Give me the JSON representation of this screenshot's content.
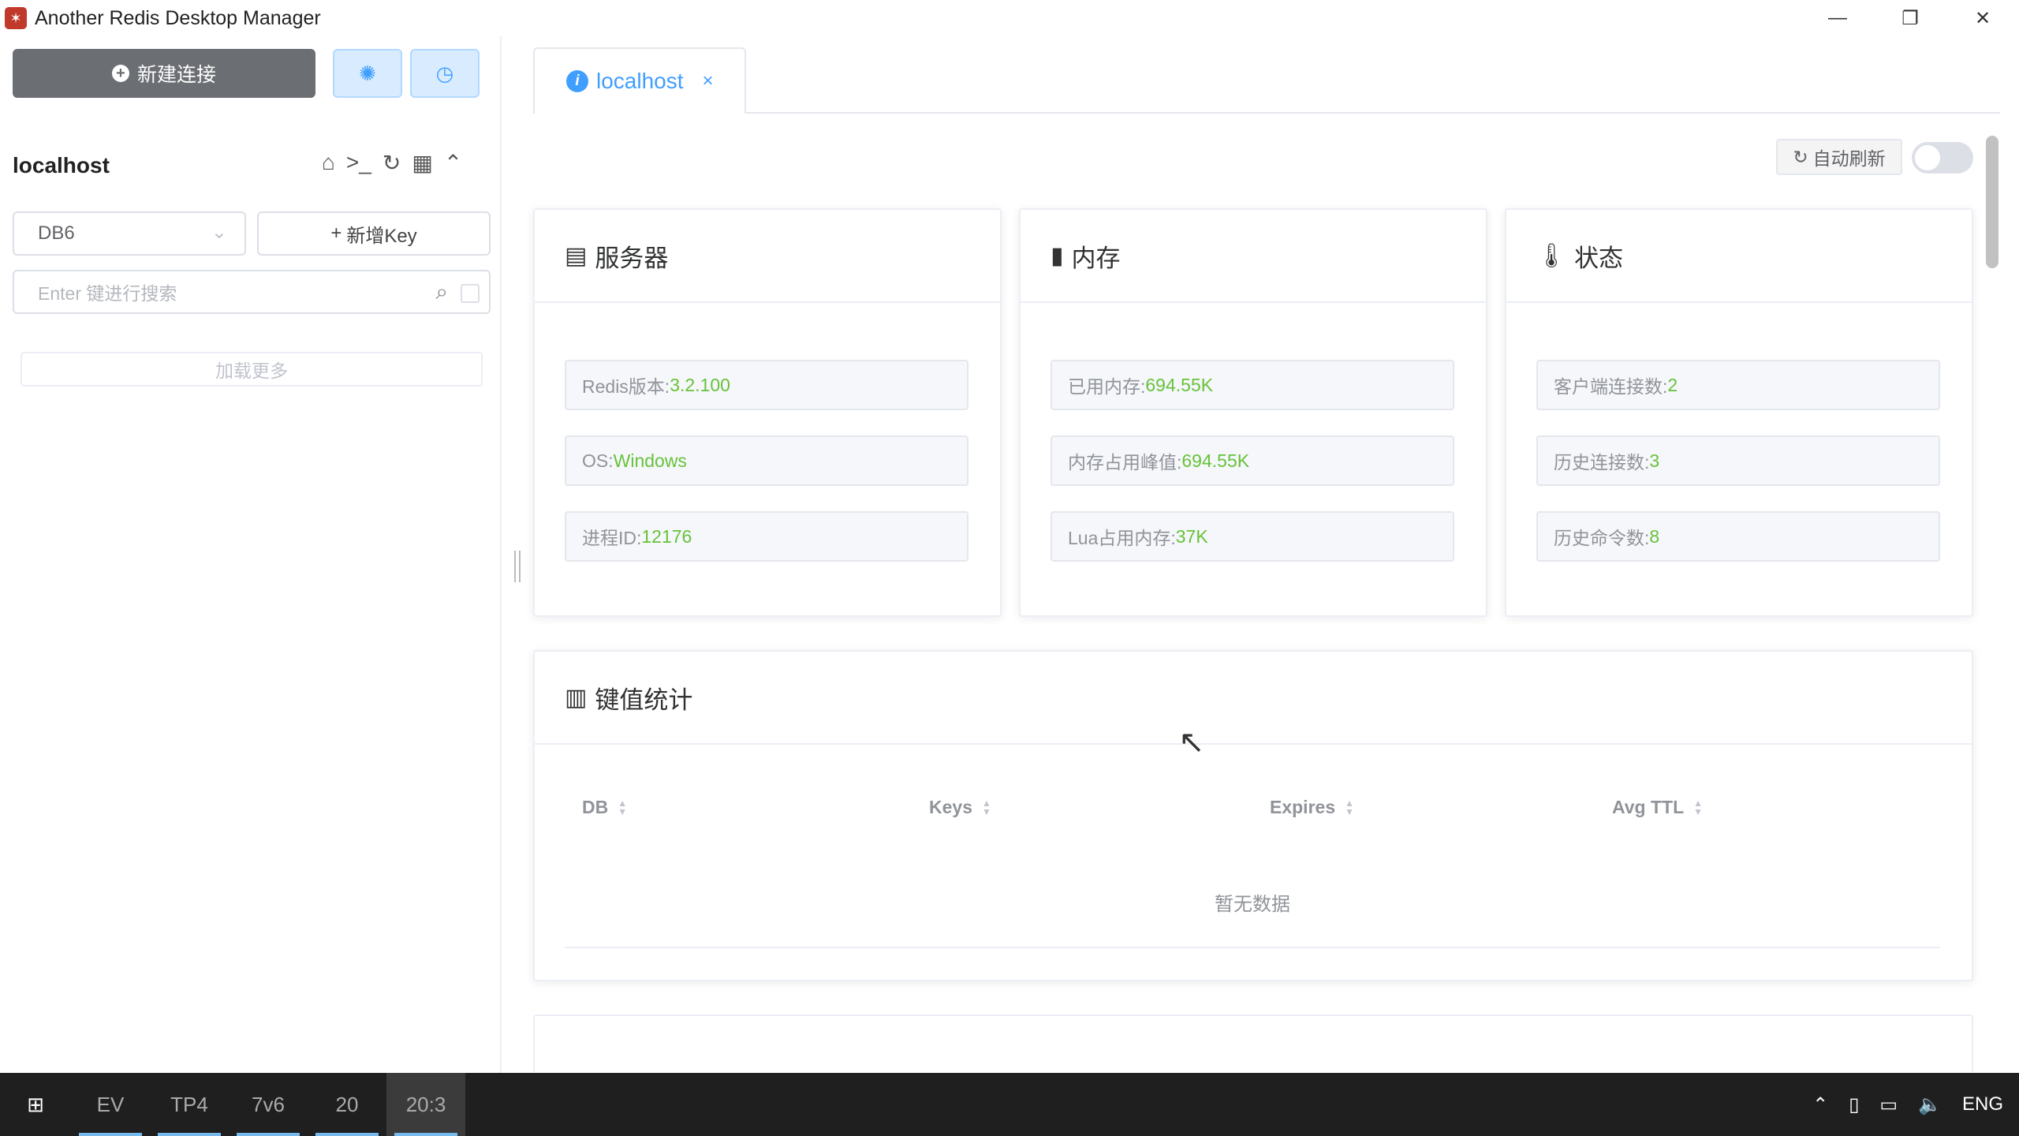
{
  "window": {
    "title": "Another Redis Desktop Manager",
    "minimize": "—",
    "restore": "❐",
    "close": "✕"
  },
  "sidebar": {
    "new_connection_label": "新建连接",
    "connection_name": "localhost",
    "db_selected": "DB6",
    "add_key_label": "新增Key",
    "search_placeholder": "Enter 键进行搜索",
    "load_more_label": "加载更多"
  },
  "tab": {
    "label": "localhost",
    "close": "×"
  },
  "toolbar": {
    "auto_refresh_label": "自动刷新",
    "auto_refresh_on": false
  },
  "server_card": {
    "title": "服务器",
    "rows": [
      {
        "label": "Redis版本: ",
        "value": "3.2.100"
      },
      {
        "label": "OS: ",
        "value": "Windows"
      },
      {
        "label": "进程ID: ",
        "value": "12176"
      }
    ]
  },
  "memory_card": {
    "title": "内存",
    "rows": [
      {
        "label": "已用内存: ",
        "value": "694.55K"
      },
      {
        "label": "内存占用峰值: ",
        "value": "694.55K"
      },
      {
        "label": "Lua占用内存: ",
        "value": "37K"
      }
    ]
  },
  "status_card": {
    "title": "状态",
    "rows": [
      {
        "label": "客户端连接数: ",
        "value": "2"
      },
      {
        "label": "历史连接数: ",
        "value": "3"
      },
      {
        "label": "历史命令数: ",
        "value": "8"
      }
    ]
  },
  "keystats_card": {
    "title": "键值统计",
    "columns": [
      "DB",
      "Keys",
      "Expires",
      "Avg TTL"
    ],
    "empty_text": "暂无数据"
  },
  "taskbar": {
    "items": [
      "EV",
      "TP4",
      "7v6",
      "20",
      "20:3"
    ],
    "tray_lang": "ENG"
  },
  "colors": {
    "primary": "#409eff",
    "value_green": "#67c23a",
    "new_conn_bg": "#6b6e73"
  }
}
